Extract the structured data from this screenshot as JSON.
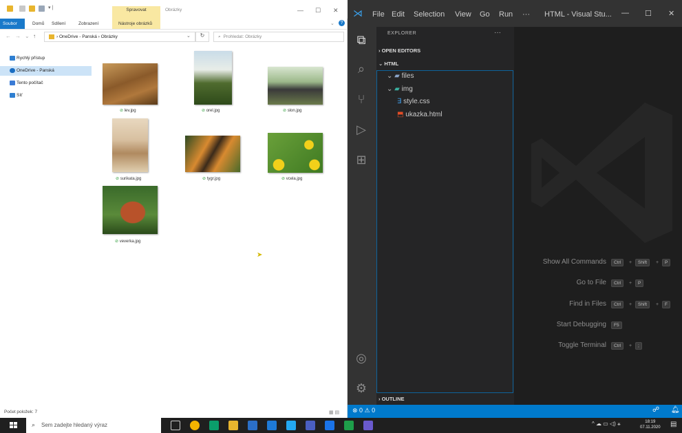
{
  "explorer": {
    "ribbon": {
      "tab_file": "Soubor",
      "tab_home": "Domů",
      "tab_share": "Sdílení",
      "tab_view": "Zobrazení",
      "tab_tools": "Nástroje obrázků",
      "context_title": "Spravovat",
      "window_title": "Obrázky"
    },
    "address_path": "› OneDrive - Panská › Obrázky",
    "search_placeholder": "Prohledat: Obrázky",
    "nav": [
      {
        "label": "Rychlý přístup",
        "color": "#2f7fd1"
      },
      {
        "label": "OneDrive - Panská",
        "color": "#1b6ec2"
      },
      {
        "label": "Tento počítač",
        "color": "#3a7bd5"
      },
      {
        "label": "Síť",
        "color": "#2f7fd1"
      }
    ],
    "files": [
      {
        "name": "lev.jpg"
      },
      {
        "name": "orel.jpg"
      },
      {
        "name": "slon.jpg"
      },
      {
        "name": "surikata.jpg"
      },
      {
        "name": "tygr.jpg"
      },
      {
        "name": "vcela.jpg"
      },
      {
        "name": "veverka.jpg"
      }
    ],
    "status": "Počet položek: 7"
  },
  "vscode": {
    "menu": [
      "File",
      "Edit",
      "Selection",
      "View",
      "Go",
      "Run",
      "···"
    ],
    "window_title": "HTML - Visual Stu...",
    "explorer_header": "EXPLORER",
    "open_editors": "OPEN EDITORS",
    "folder": "HTML",
    "tree": [
      {
        "label": "files",
        "kind": "folder"
      },
      {
        "label": "img",
        "kind": "folder"
      },
      {
        "label": "style.css",
        "kind": "css"
      },
      {
        "label": "ukazka.html",
        "kind": "html"
      }
    ],
    "outline": "OUTLINE",
    "commands": [
      {
        "label": "Show All Commands",
        "keys": [
          "Ctrl",
          "Shift",
          "P"
        ]
      },
      {
        "label": "Go to File",
        "keys": [
          "Ctrl",
          "P"
        ]
      },
      {
        "label": "Find in Files",
        "keys": [
          "Ctrl",
          "Shift",
          "F"
        ]
      },
      {
        "label": "Start Debugging",
        "keys": [
          "F5"
        ]
      },
      {
        "label": "Toggle Terminal",
        "keys": [
          "Ctrl",
          ";"
        ]
      }
    ],
    "status_left": "⊗ 0 ⚠ 0",
    "accent": "#007acc"
  },
  "taskbar": {
    "search_placeholder": "Sem zadejte hledaný výraz",
    "time": "18:19",
    "date": "07.11.2020"
  }
}
